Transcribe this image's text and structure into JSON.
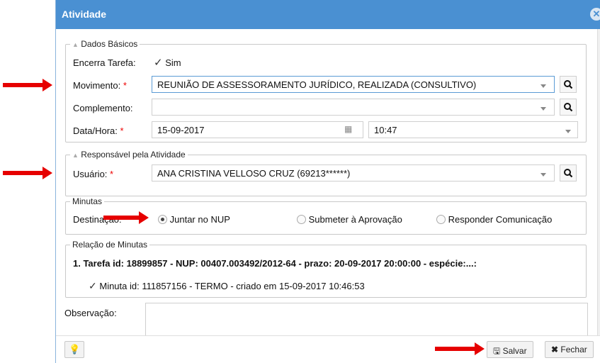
{
  "window": {
    "title": "Atividade",
    "close_icon": "close-icon"
  },
  "dados_basicos": {
    "legend": "Dados Básicos",
    "encerra_label": "Encerra Tarefa:",
    "encerra_check": "✓",
    "encerra_value": "Sim",
    "movimento_label": "Movimento:",
    "movimento_value": "REUNIÃO DE ASSESSORAMENTO JURÍDICO, REALIZADA (CONSULTIVO)",
    "complemento_label": "Complemento:",
    "complemento_value": "",
    "datahora_label": "Data/Hora:",
    "date_value": "15-09-2017",
    "time_value": "10:47"
  },
  "responsavel": {
    "legend": "Responsável pela Atividade",
    "usuario_label": "Usuário:",
    "usuario_value": "ANA CRISTINA VELLOSO CRUZ (69213******)"
  },
  "minutas": {
    "legend": "Minutas",
    "destinacao_label": "Destinação:",
    "options": [
      "Juntar no NUP",
      "Submeter à Aprovação",
      "Responder Comunicação"
    ],
    "selected": "Juntar no NUP"
  },
  "relacao": {
    "legend": "Relação de Minutas",
    "tarefa": "1. Tarefa id: 18899857 - NUP: 00407.003492/2012-64 - prazo: 20-09-2017 20:00:00 - espécie:...:",
    "minuta_check": "✓",
    "minuta": "Minuta id: 111857156 - TERMO - criado em 15-09-2017 10:46:53"
  },
  "observacao_label": "Observação:",
  "required_mark": "*",
  "footer": {
    "help_icon": "lightbulb-icon",
    "save_icon": "floppy-disk-icon",
    "save_label": "Salvar",
    "close_label_icon": "✖",
    "close_label": "Fechar"
  },
  "colors": {
    "title_bar": "#4a90d2",
    "arrow": "#e60000",
    "required": "#ee0000"
  }
}
